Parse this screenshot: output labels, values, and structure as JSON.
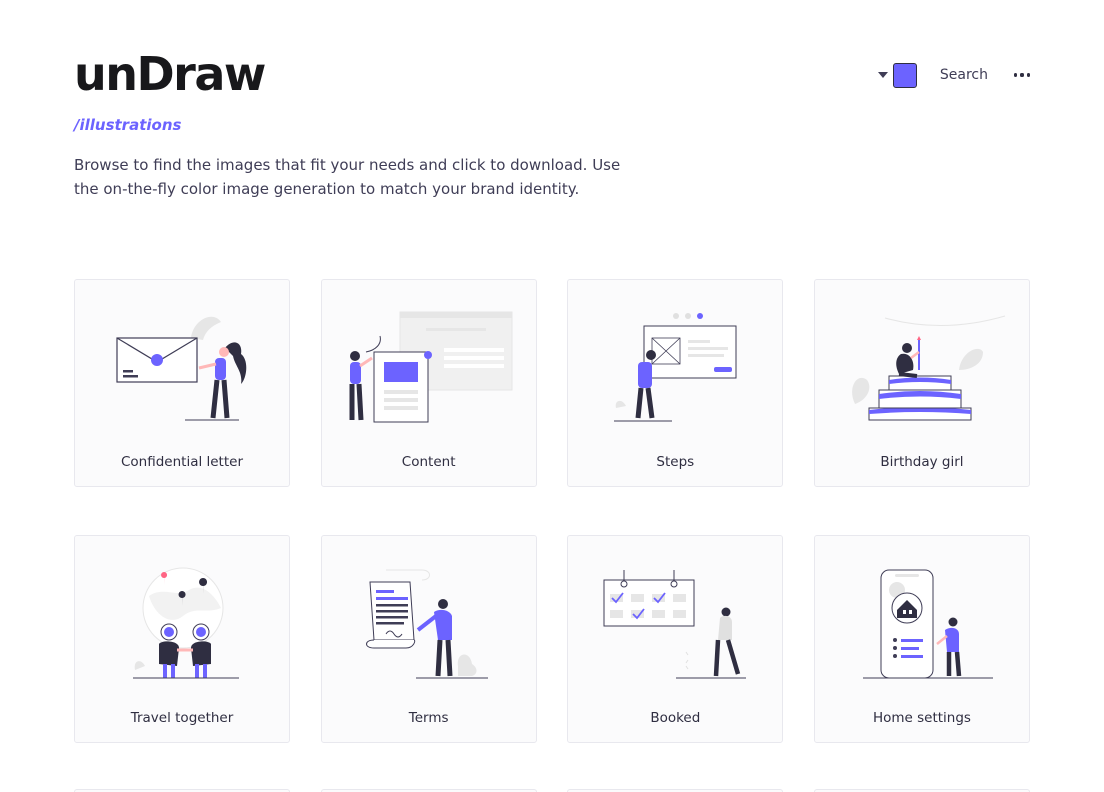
{
  "app": {
    "name": "unDraw"
  },
  "nav": {
    "search_label": "Search",
    "more_icon": "more-horizontal-icon",
    "caret_icon": "caret-down-icon"
  },
  "colors": {
    "accent": "#6c63ff",
    "text_dark": "#2f2e41",
    "line": "#3f3d56",
    "grey": "#e6e6e6",
    "card_bg": "#fbfbfc"
  },
  "header": {
    "subtitle": "/illustrations",
    "intro": "Browse to find the images that fit your needs and click to download. Use the on-the-fly color image generation to match your brand identity."
  },
  "illustrations": [
    {
      "label": "Confidential letter"
    },
    {
      "label": "Content"
    },
    {
      "label": "Steps"
    },
    {
      "label": "Birthday girl"
    },
    {
      "label": "Travel together"
    },
    {
      "label": "Terms"
    },
    {
      "label": "Booked"
    },
    {
      "label": "Home settings"
    }
  ]
}
